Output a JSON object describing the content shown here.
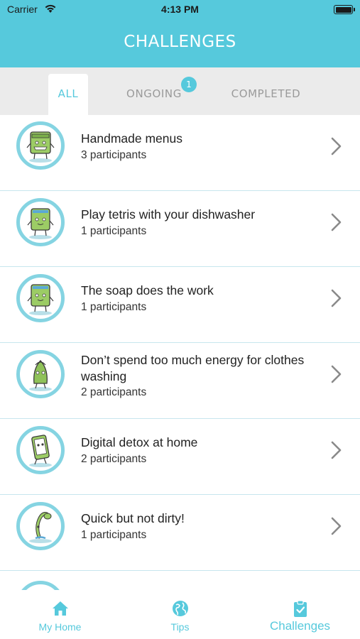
{
  "status_bar": {
    "carrier": "Carrier",
    "time": "4:13 PM"
  },
  "header": {
    "title": "CHALLENGES"
  },
  "tabs": [
    {
      "label": "ALL",
      "active": true
    },
    {
      "label": "ONGOING",
      "active": false,
      "badge": "1"
    },
    {
      "label": "COMPLETED",
      "active": false
    }
  ],
  "challenges": [
    {
      "title": "Handmade menus",
      "participants": "3 participants",
      "icon": "dishwasher-character-icon"
    },
    {
      "title": "Play tetris with your dishwasher",
      "participants": "1 participants",
      "icon": "washing-machine-character-icon"
    },
    {
      "title": "The soap does the work",
      "participants": "1 participants",
      "icon": "washing-machine-character-icon"
    },
    {
      "title": "Don’t spend too much energy for clothes washing",
      "participants": "2 participants",
      "icon": "iron-character-icon"
    },
    {
      "title": "Digital detox at home",
      "participants": "2 participants",
      "icon": "tablet-character-icon"
    },
    {
      "title": "Quick but not dirty!",
      "participants": "1 participants",
      "icon": "shower-character-icon"
    }
  ],
  "tab_bar": [
    {
      "label": "My Home",
      "icon": "home-icon",
      "active": false
    },
    {
      "label": "Tips",
      "icon": "globe-icon",
      "active": false
    },
    {
      "label": "Challenges",
      "icon": "clipboard-check-icon",
      "active": true
    }
  ],
  "colors": {
    "accent": "#56c9dc",
    "ring": "#85d4e2",
    "character_green": "#9ccc65"
  }
}
